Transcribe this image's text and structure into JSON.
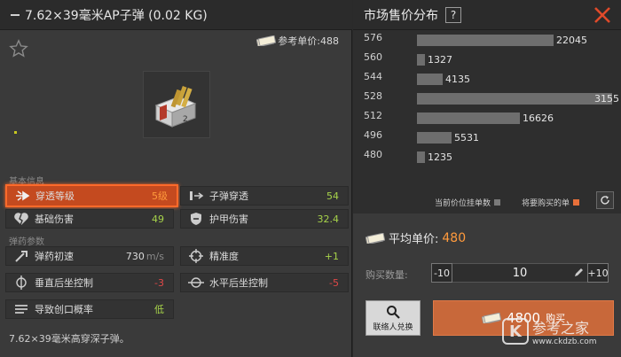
{
  "item": {
    "title": "7.62×39毫米AP子弹 (0.02 KG)",
    "ref_price_label": "参考单价:488",
    "section_basic": "基本信息",
    "section_ammo": "弹药参数",
    "description": "7.62×39毫米高穿深子弹。",
    "stats": [
      {
        "label": "穿透等级",
        "value": "5级",
        "icon": "penetration-icon",
        "color": "orange"
      },
      {
        "label": "子弹穿透",
        "value": "54",
        "icon": "bullet-penetration-icon",
        "color": "green"
      },
      {
        "label": "基础伤害",
        "value": "49",
        "icon": "broken-heart-icon",
        "color": "green"
      },
      {
        "label": "护甲伤害",
        "value": "32.4",
        "icon": "armor-damage-icon",
        "color": "green"
      },
      {
        "label": "弹药初速",
        "value": "730",
        "unit": "m/s",
        "icon": "velocity-icon",
        "color": "white"
      },
      {
        "label": "精准度",
        "value": "+1",
        "icon": "crosshair-icon",
        "color": "green"
      },
      {
        "label": "垂直后坐控制",
        "value": "-3",
        "icon": "vertical-recoil-icon",
        "color": "red"
      },
      {
        "label": "水平后坐控制",
        "value": "-5",
        "icon": "horizontal-recoil-icon",
        "color": "red"
      },
      {
        "label": "导致创口概率",
        "value": "低",
        "icon": "bleed-icon",
        "color": "green"
      }
    ]
  },
  "market": {
    "title": "市场售价分布",
    "help_label": "?",
    "legend_current": "当前价位挂单数",
    "legend_buy": "将要购买的单",
    "avg_label": "平均单价:",
    "avg_value": "480",
    "qty_label": "购买数量:",
    "qty_minus": "-10",
    "qty_value": "10",
    "qty_plus": "+10",
    "contact_label": "联络人兑换",
    "buy_price": "4800",
    "buy_label": "购买"
  },
  "chart_data": {
    "type": "bar",
    "orientation": "horizontal",
    "categories": [
      "576",
      "560",
      "544",
      "528",
      "512",
      "496",
      "480"
    ],
    "values": [
      22045,
      1327,
      4135,
      31550,
      16626,
      5531,
      1235
    ],
    "data_labels": [
      "22045",
      "1327",
      "4135",
      "3155",
      "16626",
      "5531",
      "1235"
    ]
  },
  "watermark": {
    "logo": "K",
    "name": "参考之家",
    "url": "www.ckdzb.com"
  },
  "colors": {
    "accent": "#ff9a3c",
    "highlight": "#c44a1f",
    "buy": "#c8683a",
    "bar": "#6e6e6e"
  }
}
